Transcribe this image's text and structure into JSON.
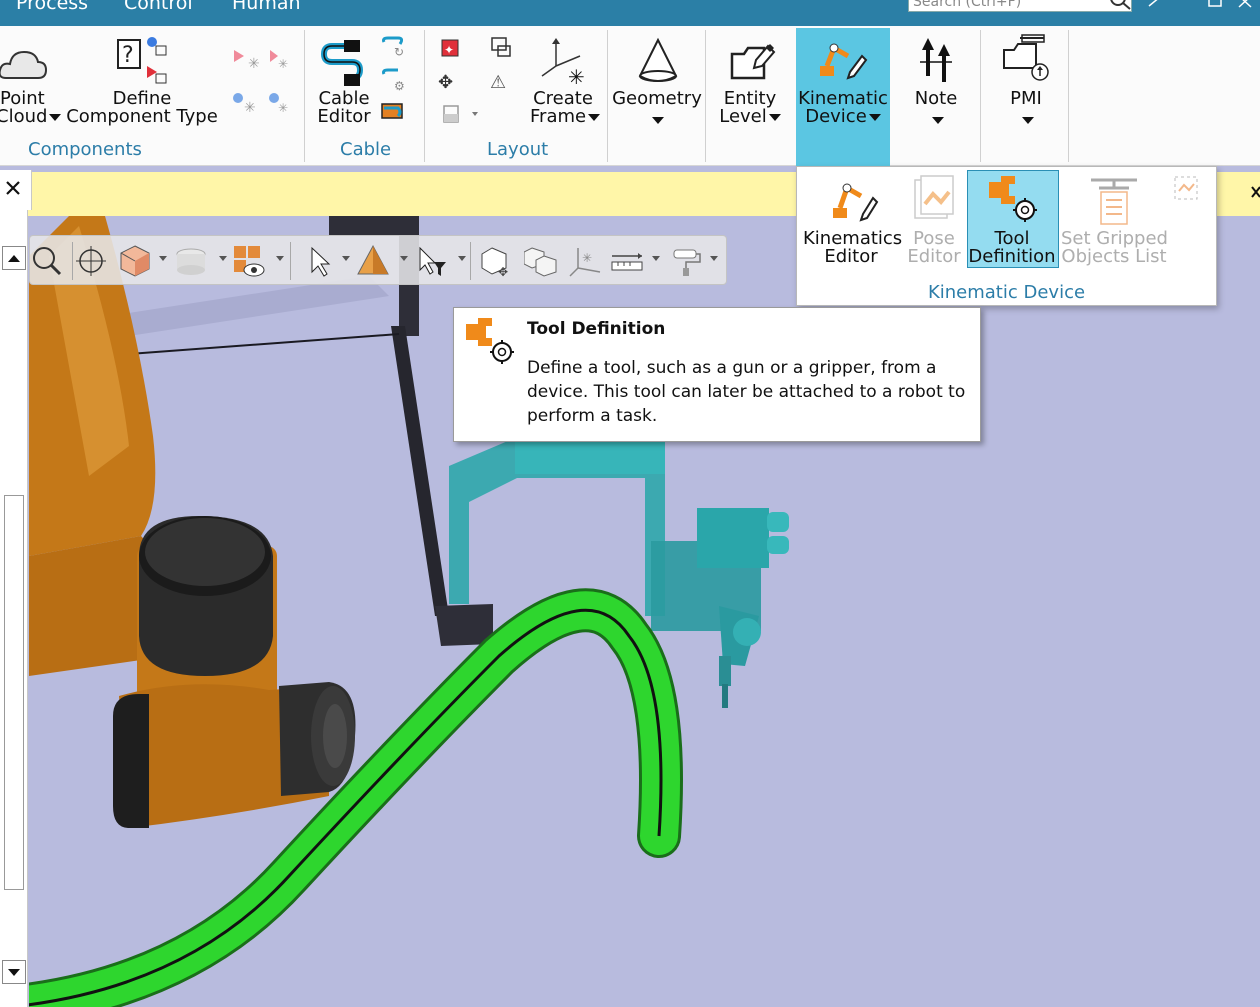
{
  "tabs": [
    "Process",
    "Control",
    "Human"
  ],
  "search": {
    "placeholder": "Search (Ctrl+F)"
  },
  "ribbon": {
    "point_cloud": {
      "line1": "Point",
      "line2": "Cloud"
    },
    "define_component": {
      "line1": "Define",
      "line2": "Component Type"
    },
    "cable_editor": {
      "line1": "Cable",
      "line2": "Editor"
    },
    "create_frame": {
      "line1": "Create",
      "line2": "Frame"
    },
    "geometry": {
      "line1": "Geometry"
    },
    "entity_level": {
      "line1": "Entity",
      "line2": "Level"
    },
    "kinematic_device": {
      "line1": "Kinematic",
      "line2": "Device"
    },
    "note": {
      "line1": "Note"
    },
    "pmi": {
      "line1": "PMI"
    },
    "groups": {
      "components": "Components",
      "cable": "Cable",
      "layout": "Layout"
    }
  },
  "dropdown": {
    "items": [
      {
        "line1": "Kinematics",
        "line2": "Editor",
        "enabled": true
      },
      {
        "line1": "Pose",
        "line2": "Editor",
        "enabled": false
      },
      {
        "line1": "Tool",
        "line2": "Definition",
        "enabled": true,
        "selected": true
      },
      {
        "line1": "Set Gripped",
        "line2": "Objects List",
        "enabled": false
      }
    ],
    "group_label": "Kinematic Device"
  },
  "tooltip": {
    "title": "Tool Definition",
    "description": "Define a tool, such as a gun or a gripper, from a device. This tool can later be attached to a robot to perform a task."
  },
  "colors": {
    "accent": "#2c7da8",
    "title_bar": "#2b7fa6",
    "selected_button": "#5bc6e2",
    "viewport_bg": "#b8bbde",
    "infobar": "#fff6a8",
    "cable": "#2ed62e",
    "robot": "#c87a1a",
    "gripper": "#2aa6aa"
  }
}
